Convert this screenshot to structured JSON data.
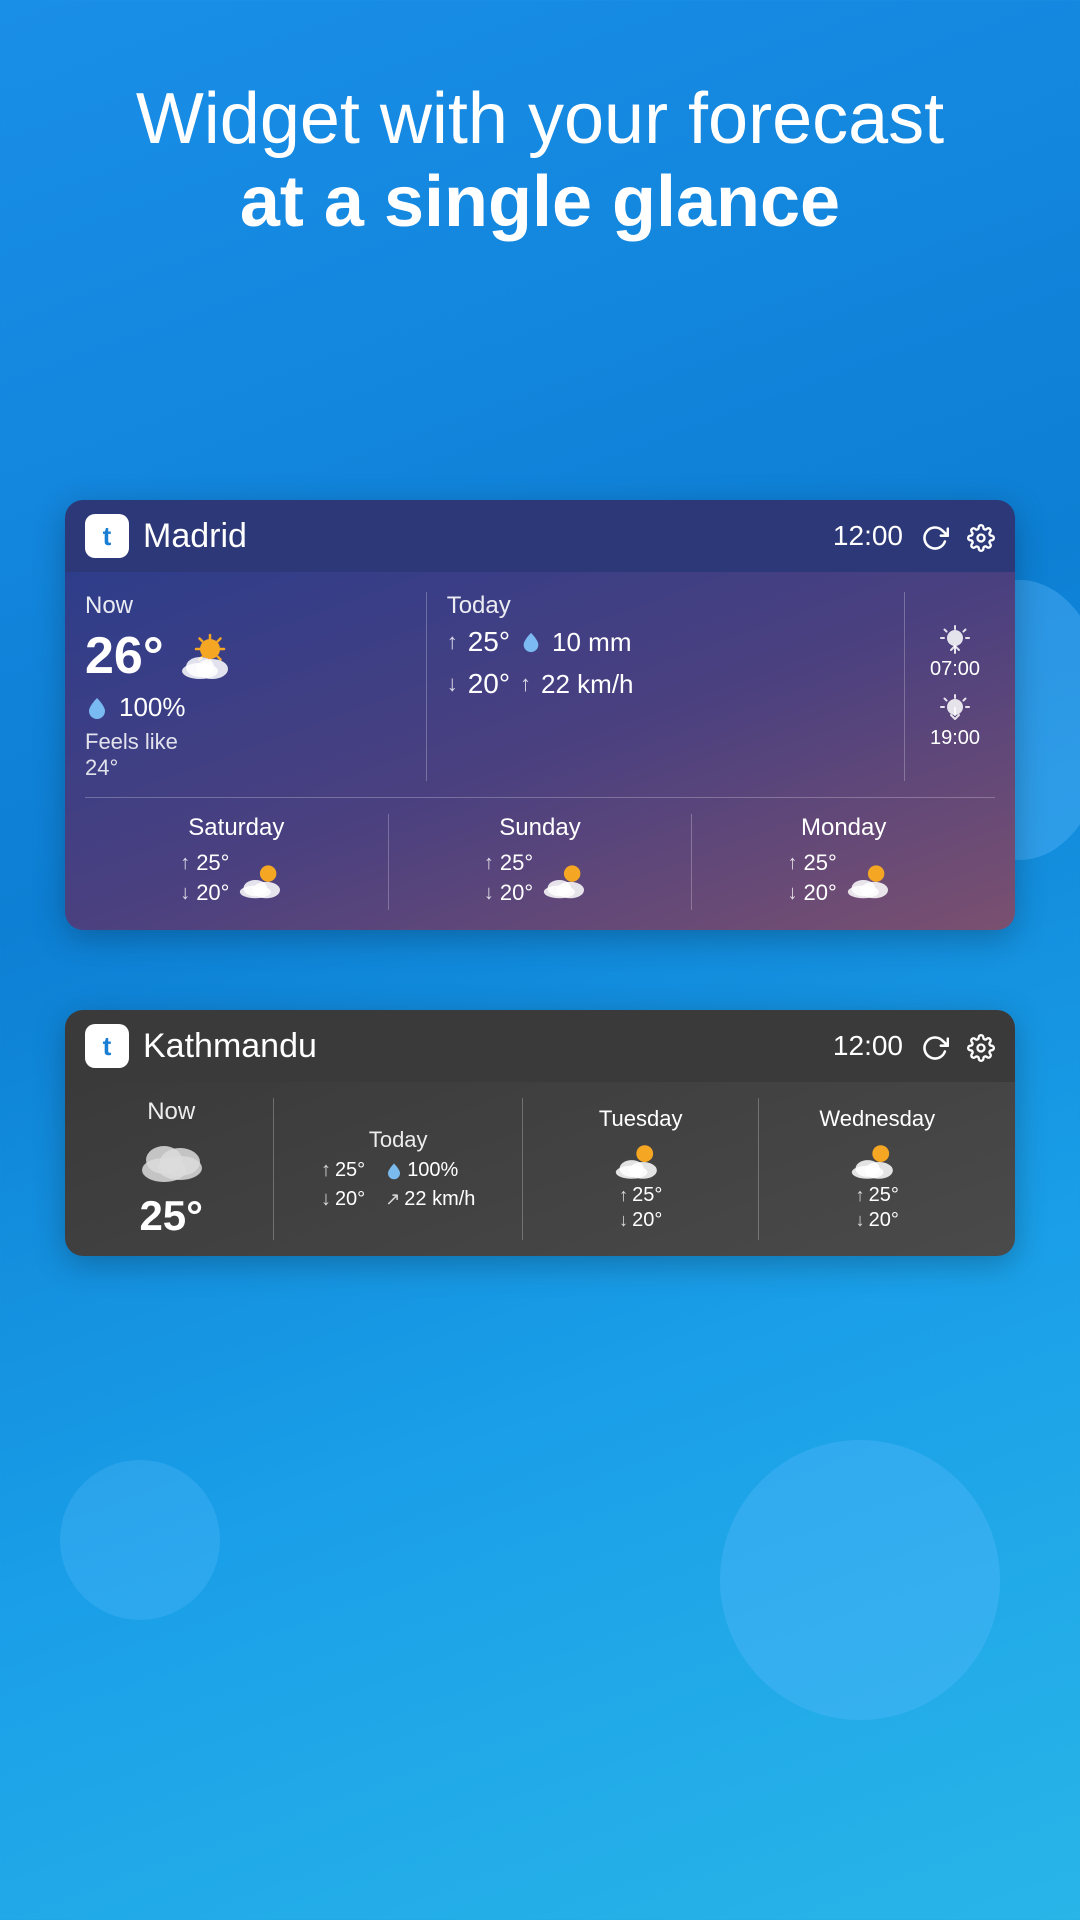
{
  "hero": {
    "line1": "Widget with your forecast",
    "line2": "at a single glance"
  },
  "madrid_widget": {
    "app_logo": "t",
    "city": "Madrid",
    "time": "12:00",
    "now": {
      "label": "Now",
      "temp": "26°",
      "humidity": "100%",
      "feels_like": "Feels like",
      "feels_like_temp": "24°"
    },
    "today": {
      "label": "Today",
      "high": "25°",
      "low": "20°",
      "rain": "10 mm",
      "wind": "22 km/h"
    },
    "sunrise": "07:00",
    "sunset": "19:00",
    "forecast": [
      {
        "day": "Saturday",
        "high": "25°",
        "low": "20°"
      },
      {
        "day": "Sunday",
        "high": "25°",
        "low": "20°"
      },
      {
        "day": "Monday",
        "high": "25°",
        "low": "20°"
      }
    ]
  },
  "kathmandu_widget": {
    "app_logo": "t",
    "city": "Kathmandu",
    "time": "12:00",
    "now": {
      "label": "Now",
      "temp": "25°"
    },
    "today": {
      "label": "Today",
      "high": "25°",
      "low": "20°",
      "humidity": "100%",
      "wind": "22 km/h"
    },
    "forecast": [
      {
        "day": "Tuesday",
        "high": "25°",
        "low": "20°"
      },
      {
        "day": "Wednesday",
        "high": "25°",
        "low": "20°"
      }
    ]
  }
}
